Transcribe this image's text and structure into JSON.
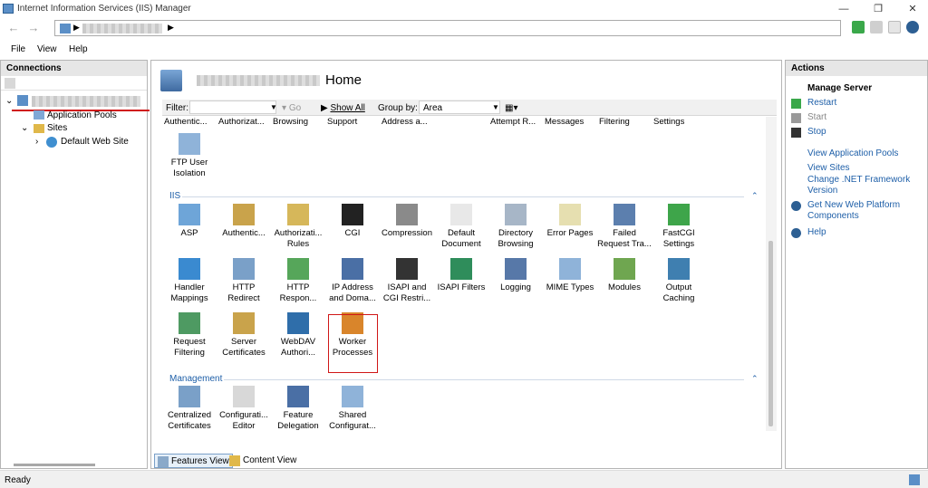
{
  "window": {
    "title": "Internet Information Services (IIS) Manager"
  },
  "menu": {
    "file": "File",
    "view": "View",
    "help": "Help"
  },
  "connections": {
    "header": "Connections",
    "tree": [
      {
        "label": "Application Pools"
      },
      {
        "label": "Sites"
      },
      {
        "label": "Default Web Site"
      }
    ]
  },
  "main": {
    "home_label": "Home",
    "filter_label": "Filter:",
    "go_label": "Go",
    "show_all_label": "Show All",
    "group_by_label": "Group by:",
    "group_by_value": "Area",
    "top_row": [
      "Authentic...",
      "Authorizat...",
      "Browsing",
      "Support",
      "Address a...",
      "Attempt R...",
      "Messages",
      "Filtering",
      "Settings"
    ],
    "ftp_item": "FTP User\nIsolation",
    "iis_group": "IIS",
    "iis_features": [
      "ASP",
      "Authentic...",
      "Authorizati...\nRules",
      "CGI",
      "Compression",
      "Default\nDocument",
      "Directory\nBrowsing",
      "Error Pages",
      "Failed\nRequest Tra...",
      "FastCGI\nSettings",
      "Handler\nMappings",
      "HTTP\nRedirect",
      "HTTP\nRespon...",
      "IP Address\nand Doma...",
      "ISAPI and\nCGI Restri...",
      "ISAPI Filters",
      "Logging",
      "MIME Types",
      "Modules",
      "Output\nCaching",
      "Request\nFiltering",
      "Server\nCertificates",
      "WebDAV\nAuthori...",
      "Worker\nProcesses"
    ],
    "management_group": "Management",
    "management_features": [
      "Centralized\nCertificates",
      "Configurati...\nEditor",
      "Feature\nDelegation",
      "Shared\nConfigurat..."
    ],
    "features_view": "Features View",
    "content_view": "Content View"
  },
  "actions": {
    "header": "Actions",
    "section": "Manage Server",
    "items": [
      "Restart",
      "Start",
      "Stop",
      "View Application Pools",
      "View Sites",
      "Change .NET Framework Version",
      "Get New Web Platform Components",
      "Help"
    ]
  },
  "status": "Ready",
  "colors": {
    "link": "#1e5fa8",
    "highlight": "#d01717",
    "panel_header": "#e6e6e6"
  }
}
